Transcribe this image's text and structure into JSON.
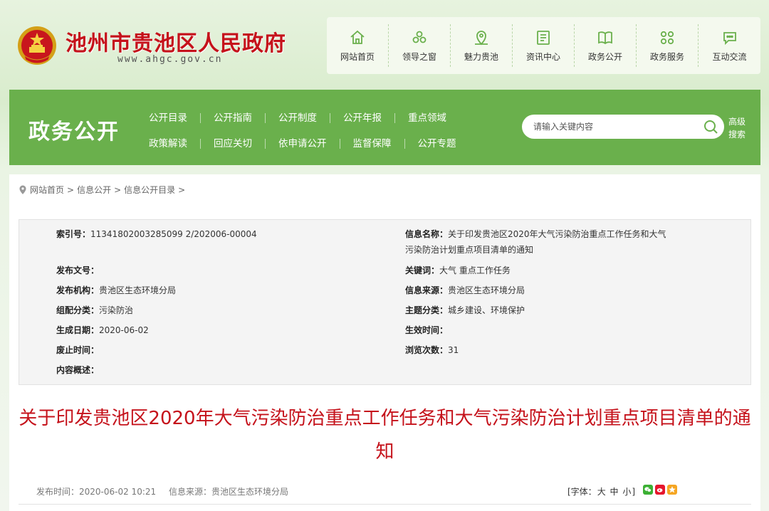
{
  "header": {
    "site_name": "池州市贵池区人民政府",
    "site_url": "www.ahgc.gov.cn",
    "nav": [
      {
        "label": "网站首页",
        "icon": "home-icon"
      },
      {
        "label": "领导之窗",
        "icon": "leaders-icon"
      },
      {
        "label": "魅力贵池",
        "icon": "map-pin-icon"
      },
      {
        "label": "资讯中心",
        "icon": "news-icon"
      },
      {
        "label": "政务公开",
        "icon": "book-icon"
      },
      {
        "label": "政务服务",
        "icon": "grid-icon"
      },
      {
        "label": "互动交流",
        "icon": "chat-icon"
      }
    ]
  },
  "band": {
    "title": "政务公开",
    "nav_row1": [
      "公开目录",
      "公开指南",
      "公开制度",
      "公开年报",
      "重点领域"
    ],
    "nav_row2": [
      "政策解读",
      "回应关切",
      "依申请公开",
      "监督保障",
      "公开专题"
    ],
    "search_placeholder": "请输入关键内容",
    "advanced_search": "高级搜索"
  },
  "breadcrumb": [
    "网站首页",
    "信息公开",
    "信息公开目录"
  ],
  "breadcrumb_sep": ">",
  "info": {
    "index_label": "索引号：",
    "index_value": "11341802003285099 2/202006-00004",
    "doc_no_label": "发布文号：",
    "doc_no_value": "",
    "publisher_label": "发布机构：",
    "publisher_value": "贵池区生态环境分局",
    "category_label": "组配分类：",
    "category_value": "污染防治",
    "created_label": "生成日期：",
    "created_value": "2020-06-02",
    "expire_label": "废止时间：",
    "expire_value": "",
    "summary_label": "内容概述：",
    "summary_value": "",
    "name_label": "信息名称：",
    "name_value": "关于印发贵池区2020年大气污染防治重点工作任务和大气污染防治计划重点项目清单的通知",
    "keywords_label": "关键词：",
    "keywords_value": "大气 重点工作任务",
    "source_label": "信息来源：",
    "source_value": "贵池区生态环境分局",
    "topic_label": "主题分类：",
    "topic_value": "城乡建设、环境保护",
    "effective_label": "生效时间：",
    "effective_value": "",
    "views_label": "浏览次数：",
    "views_value": "31"
  },
  "article": {
    "title": "关于印发贵池区2020年大气污染防治重点工作任务和大气污染防治计划重点项目清单的通知",
    "publish_time": "发布时间：2020-06-02 10:21",
    "source": "信息来源：贵池区生态环境分局",
    "font_prefix": "[字体：",
    "font_large": "大",
    "font_medium": "中",
    "font_small": "小",
    "font_suffix": "]"
  },
  "colors": {
    "brand_red": "#c5121b",
    "band_green": "#6ab04c",
    "wechat_green": "#3cb034",
    "weibo_red": "#e6162d",
    "qzone_orange": "#f5a623"
  }
}
